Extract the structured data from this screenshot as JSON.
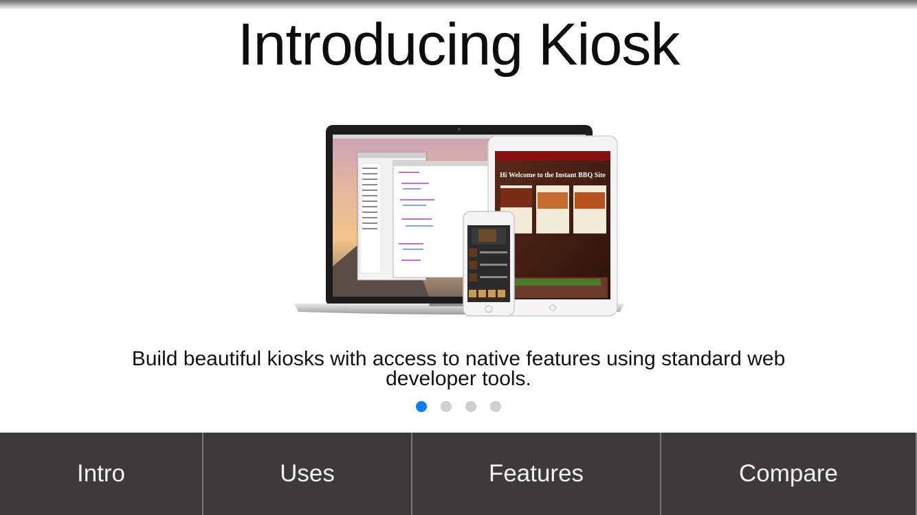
{
  "header": {
    "title": "Introducing Kiosk"
  },
  "hero": {
    "image": "devices-mockup",
    "site_title": "Hi Welcome to the Instant BBQ Site"
  },
  "body": {
    "tagline": "Build beautiful kiosks with access to native features using standard web developer tools."
  },
  "pager": {
    "count": 4,
    "active_index": 0,
    "active_color": "#0a7ef5",
    "inactive_color": "#cfcfcf"
  },
  "tabbar": {
    "background": "#3d3b3a",
    "tabs": [
      {
        "label": "Intro"
      },
      {
        "label": "Uses"
      },
      {
        "label": "Features"
      },
      {
        "label": "Compare"
      }
    ]
  }
}
